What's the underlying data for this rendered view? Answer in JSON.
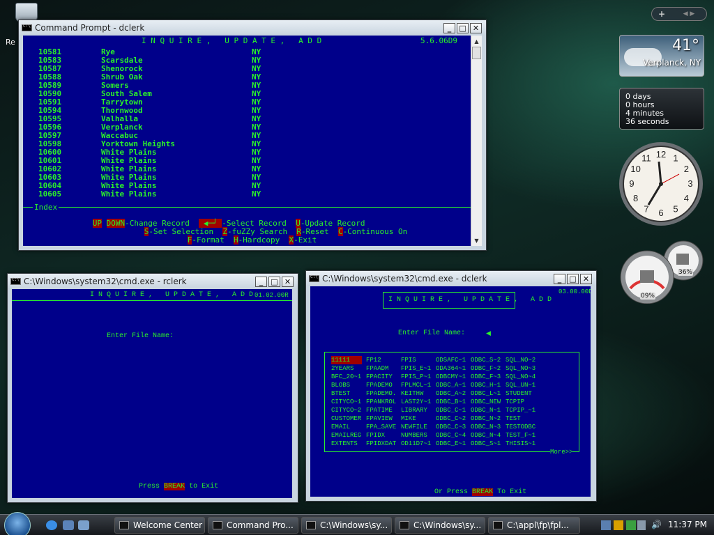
{
  "desktop": {
    "icon_label": "Re"
  },
  "sidebar": {
    "add_label": "+",
    "nav_label": "◀ ▶"
  },
  "weather": {
    "temp": "41°",
    "city": "Verplanck, NY"
  },
  "countdown": {
    "days": "0 days",
    "hours": "0 hours",
    "minutes": "4 minutes",
    "seconds": "36 seconds"
  },
  "clock": {
    "numbers": [
      "12",
      "1",
      "2",
      "3",
      "4",
      "5",
      "6",
      "7",
      "8",
      "9",
      "10",
      "11"
    ]
  },
  "meter": {
    "cpu": "09%",
    "mem": "36%"
  },
  "win1": {
    "title": "Command Prompt - dclerk",
    "header": "I N Q U I R E ,   U P D A T E ,   A D D",
    "version": "5.6.06D9",
    "index_label": "Index",
    "rows": [
      [
        "10581",
        "Rye",
        "NY"
      ],
      [
        "10583",
        "Scarsdale",
        "NY"
      ],
      [
        "10587",
        "Shenorock",
        "NY"
      ],
      [
        "10588",
        "Shrub Oak",
        "NY"
      ],
      [
        "10589",
        "Somers",
        "NY"
      ],
      [
        "10590",
        "South Salem",
        "NY"
      ],
      [
        "10591",
        "Tarrytown",
        "NY"
      ],
      [
        "10594",
        "Thornwood",
        "NY"
      ],
      [
        "10595",
        "Valhalla",
        "NY"
      ],
      [
        "10596",
        "Verplanck",
        "NY"
      ],
      [
        "10597",
        "Waccabuc",
        "NY"
      ],
      [
        "10598",
        "Yorktown Heights",
        "NY"
      ],
      [
        "10600",
        "White Plains",
        "NY"
      ],
      [
        "10601",
        "White Plains",
        "NY"
      ],
      [
        "10602",
        "White Plains",
        "NY"
      ],
      [
        "10603",
        "White Plains",
        "NY"
      ],
      [
        "10604",
        "White Plains",
        "NY"
      ],
      [
        "10605",
        "White Plains",
        "NY"
      ]
    ],
    "selected_row": 9,
    "keys": {
      "up": "UP",
      "down": "DOWN",
      "change": "-Change Record",
      "select": "-Select Record",
      "u": "U",
      "update": "-Update Record",
      "s": "S",
      "set": "-Set Selection",
      "z": "Z",
      "fuzzy": "-fuZZy Search",
      "r": "R",
      "reset": "-Reset",
      "c": "C",
      "continuous": "-Continuous On",
      "f": "F",
      "format": "-Format",
      "h": "H",
      "hardcopy": "-Hardcopy",
      "x": "X",
      "exit": "-Exit"
    }
  },
  "win2": {
    "title": "C:\\Windows\\system32\\cmd.exe - rclerk",
    "header": "I N Q U I R E ,   U P D A T E ,   A D D",
    "version": "01.02.00R",
    "prompt": "Enter File Name:",
    "press": "Press",
    "break": "BREAK",
    "to_exit": "to Exit"
  },
  "win3": {
    "title": "C:\\Windows\\system32\\cmd.exe - dclerk",
    "header": "I N Q U I R E ,   U P D A T E ,   A D D",
    "version": "03.00.00D",
    "prompt": "Enter File Name:",
    "or_press": "Or Press",
    "break": "BREAK",
    "to_exit": "To Exit",
    "more": "More>>",
    "files": [
      [
        "11111",
        "FP12",
        "FPIS",
        "ODSAFC~1",
        "ODBC_S~2",
        "SQL_NO~2"
      ],
      [
        "2YEARS",
        "FPAADM",
        "FPIS_E~1",
        "ODA364~1",
        "ODBC_F~2",
        "SQL_NO~3"
      ],
      [
        "BFC_20~1",
        "FPACITY",
        "FPIS_P~1",
        "ODBCMY~1",
        "ODBC_F~3",
        "SQL_NO~4"
      ],
      [
        "BLOBS",
        "FPADEMO",
        "FPLMCL~1",
        "ODBC_A~1",
        "ODBC_H~1",
        "SQL_UN~1"
      ],
      [
        "BTEST",
        "FPADEMO.",
        "KEITHW",
        "ODBC_A~2",
        "ODBC_L~1",
        "STUDENT"
      ],
      [
        "CITYCO~1",
        "FPANKROL",
        "LAST2Y~1",
        "ODBC_B~1",
        "ODBC_NEW",
        "TCPIP"
      ],
      [
        "CITYCO~2",
        "FPATIME",
        "LIBRARY",
        "ODBC_C~1",
        "ODBC_N~1",
        "TCPIP_~1"
      ],
      [
        "CUSTOMER",
        "FPAVIEW",
        "MIKE",
        "ODBC_C~2",
        "ODBC_N~2",
        "TEST"
      ],
      [
        "EMAIL",
        "FPA_SAVE",
        "NEWFILE",
        "ODBC_C~3",
        "ODBC_N~3",
        "TESTODBC"
      ],
      [
        "EMAILREG",
        "FPIDX",
        "NUMBERS",
        "ODBC_C~4",
        "ODBC_N~4",
        "TEST_F~1"
      ],
      [
        "EXTENTS",
        "FPIDXDAT",
        "OD11D7~1",
        "ODBC_E~1",
        "ODBC_S~1",
        "THISIS~1"
      ]
    ]
  },
  "taskbar": {
    "items": [
      "Welcome Center",
      "Command Pro...",
      "C:\\Windows\\sy...",
      "C:\\Windows\\sy...",
      "C:\\appl\\fp\\fpl..."
    ],
    "time": "11:37 PM"
  }
}
